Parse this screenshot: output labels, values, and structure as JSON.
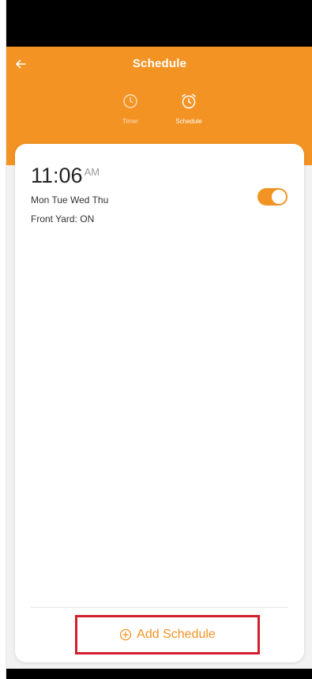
{
  "header": {
    "title": "Schedule",
    "back_icon": "arrow-left-icon",
    "background_color": "#f39323"
  },
  "tabs": [
    {
      "label": "Timer",
      "icon": "clock-icon",
      "active": false
    },
    {
      "label": "Schedule",
      "icon": "alarm-clock-icon",
      "active": true
    }
  ],
  "schedules": [
    {
      "time": "11:06",
      "period": "AM",
      "days": "Mon Tue Wed Thu",
      "action": "Front Yard: ON",
      "enabled": true
    }
  ],
  "footer": {
    "add_label": "Add Schedule",
    "add_icon": "plus-circle-icon",
    "accent_color": "#f39323",
    "highlight_color": "#d0202e"
  }
}
